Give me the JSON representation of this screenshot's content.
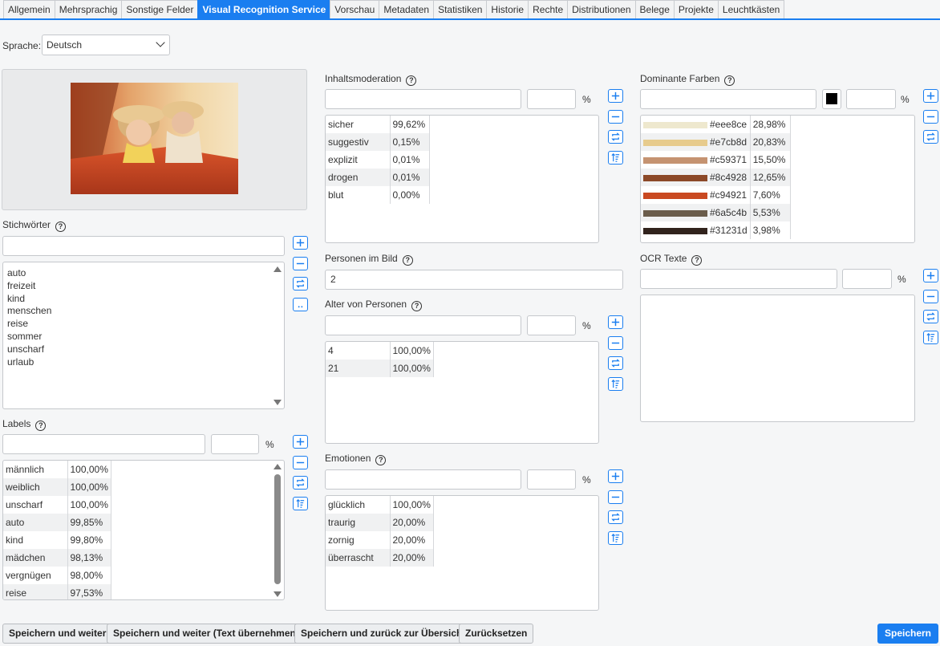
{
  "tabs": [
    "Allgemein",
    "Mehrsprachig",
    "Sonstige Felder",
    "Visual Recognition Service",
    "Vorschau",
    "Metadaten",
    "Statistiken",
    "Historie",
    "Rechte",
    "Distributionen",
    "Belege",
    "Projekte",
    "Leuchtkästen"
  ],
  "active_tab": 3,
  "language": {
    "label": "Sprache:",
    "value": "Deutsch"
  },
  "keywords": {
    "title": "Stichwörter",
    "items": [
      "auto",
      "freizeit",
      "kind",
      "menschen",
      "reise",
      "sommer",
      "unscharf",
      "urlaub"
    ],
    "more_label": ".."
  },
  "labels": {
    "title": "Labels",
    "pct": "%",
    "rows": [
      [
        "männlich",
        "100,00%"
      ],
      [
        "weiblich",
        "100,00%"
      ],
      [
        "unscharf",
        "100,00%"
      ],
      [
        "auto",
        "99,85%"
      ],
      [
        "kind",
        "99,80%"
      ],
      [
        "mädchen",
        "98,13%"
      ],
      [
        "vergnügen",
        "98,00%"
      ],
      [
        "reise",
        "97,53%"
      ]
    ]
  },
  "moderation": {
    "title": "Inhaltsmoderation",
    "pct": "%",
    "rows": [
      [
        "sicher",
        "99,62%"
      ],
      [
        "suggestiv",
        "0,15%"
      ],
      [
        "explizit",
        "0,01%"
      ],
      [
        "drogen",
        "0,01%"
      ],
      [
        "blut",
        "0,00%"
      ]
    ]
  },
  "persons": {
    "title": "Personen im Bild",
    "value": "2"
  },
  "ages": {
    "title": "Alter von Personen",
    "pct": "%",
    "rows": [
      [
        "4",
        "100,00%"
      ],
      [
        "21",
        "100,00%"
      ]
    ]
  },
  "emotions": {
    "title": "Emotionen",
    "pct": "%",
    "rows": [
      [
        "glücklich",
        "100,00%"
      ],
      [
        "traurig",
        "20,00%"
      ],
      [
        "zornig",
        "20,00%"
      ],
      [
        "überrascht",
        "20,00%"
      ]
    ]
  },
  "colors": {
    "title": "Dominante Farben",
    "pct": "%",
    "picker_color": "#000000",
    "rows": [
      {
        "hex": "#eee8ce",
        "pct": "28,98%"
      },
      {
        "hex": "#e7cb8d",
        "pct": "20,83%"
      },
      {
        "hex": "#c59371",
        "pct": "15,50%"
      },
      {
        "hex": "#8c4928",
        "pct": "12,65%"
      },
      {
        "hex": "#c94921",
        "pct": "7,60%"
      },
      {
        "hex": "#6a5c4b",
        "pct": "5,53%"
      },
      {
        "hex": "#31231d",
        "pct": "3,98%"
      }
    ]
  },
  "ocr": {
    "title": "OCR Texte",
    "pct": "%"
  },
  "buttons": {
    "save_next": "Speichern und weiter",
    "save_next_text": "Speichern und weiter (Text übernehmen)",
    "save_back": "Speichern und zurück zur Übersicht",
    "reset": "Zurücksetzen",
    "save": "Speichern"
  },
  "accent_color": "#1a7ef0"
}
